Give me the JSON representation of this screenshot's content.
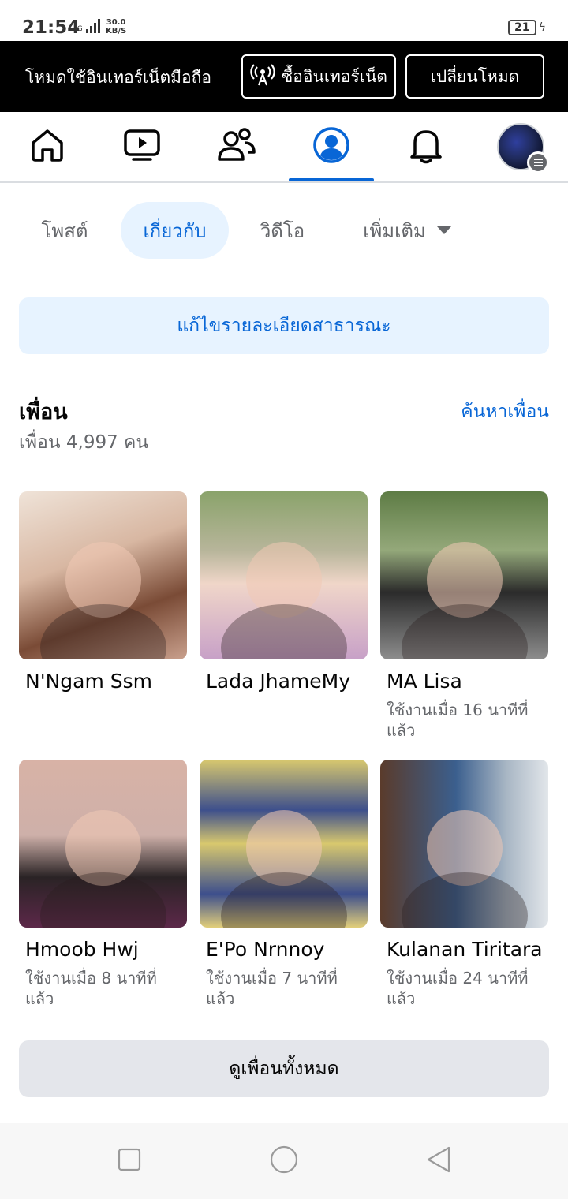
{
  "status_bar": {
    "time": "21:54",
    "network": "4G",
    "speed_value": "30.0",
    "speed_unit": "KB/S",
    "battery": "21"
  },
  "data_mode": {
    "text": "โหมดใช้อินเทอร์เน็ตมือถือ",
    "buy_label": "ซื้ออินเทอร์เน็ต",
    "switch_label": "เปลี่ยนโหมด"
  },
  "navbar": {
    "items": [
      "home-icon",
      "watch-icon",
      "friends-icon",
      "profile-icon",
      "notifications-icon",
      "menu-avatar"
    ],
    "active": "profile-icon",
    "accent": "#0866d6"
  },
  "profile_tabs": {
    "posts": "โพสต์",
    "about": "เกี่ยวกับ",
    "videos": "วิดีโอ",
    "more": "เพิ่มเติม",
    "active": "about"
  },
  "edit_details_label": "แก้ไขรายละเอียดสาธารณะ",
  "friends": {
    "title": "เพื่อน",
    "count": "เพื่อน 4,997 คน",
    "find_label": "ค้นหาเพื่อน",
    "list": [
      {
        "name": "N'Ngam Ssm",
        "status": ""
      },
      {
        "name": "Lada JhameMy",
        "status": ""
      },
      {
        "name": "MA Lisa",
        "status": "ใช้งานเมื่อ 16 นาทีที่แล้ว"
      },
      {
        "name": "Hmoob Hwj",
        "status": "ใช้งานเมื่อ 8 นาทีที่แล้ว"
      },
      {
        "name": "E'Po Nrnnoy",
        "status": "ใช้งานเมื่อ 7 นาทีที่แล้ว"
      },
      {
        "name": "Kulanan Tiritara",
        "status": "ใช้งานเมื่อ 24 นาทีที่แล้ว"
      }
    ],
    "see_all_label": "ดูเพื่อนทั้งหมด"
  },
  "system_nav": [
    "recents-icon",
    "home-circle-icon",
    "back-icon"
  ]
}
